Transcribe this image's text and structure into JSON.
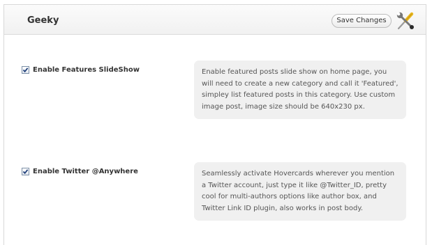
{
  "header": {
    "title": "Geeky",
    "save_label": "Save Changes",
    "tools_icon": "wrench-screwdriver-icon"
  },
  "options": [
    {
      "label": "Enable Features SlideShow",
      "checked": true,
      "description": "Enable featured posts slide show on home page, you will need to create a new category and call it 'Featured', simpley list featured posts in this category. Use custom image post, image size should be 640x230 px."
    },
    {
      "label": "Enable Twitter @Anywhere",
      "checked": true,
      "description": "Seamlessly activate Hovercards wherever you mention a Twitter account, just type it like @Twitter_ID, pretty cool for multi-authors options like author box, and Twitter Link ID plugin, also works in post body."
    }
  ],
  "colors": {
    "accent": "#333333",
    "description_bg": "#f0f0f0",
    "checkmark": "#1f3f7a"
  }
}
